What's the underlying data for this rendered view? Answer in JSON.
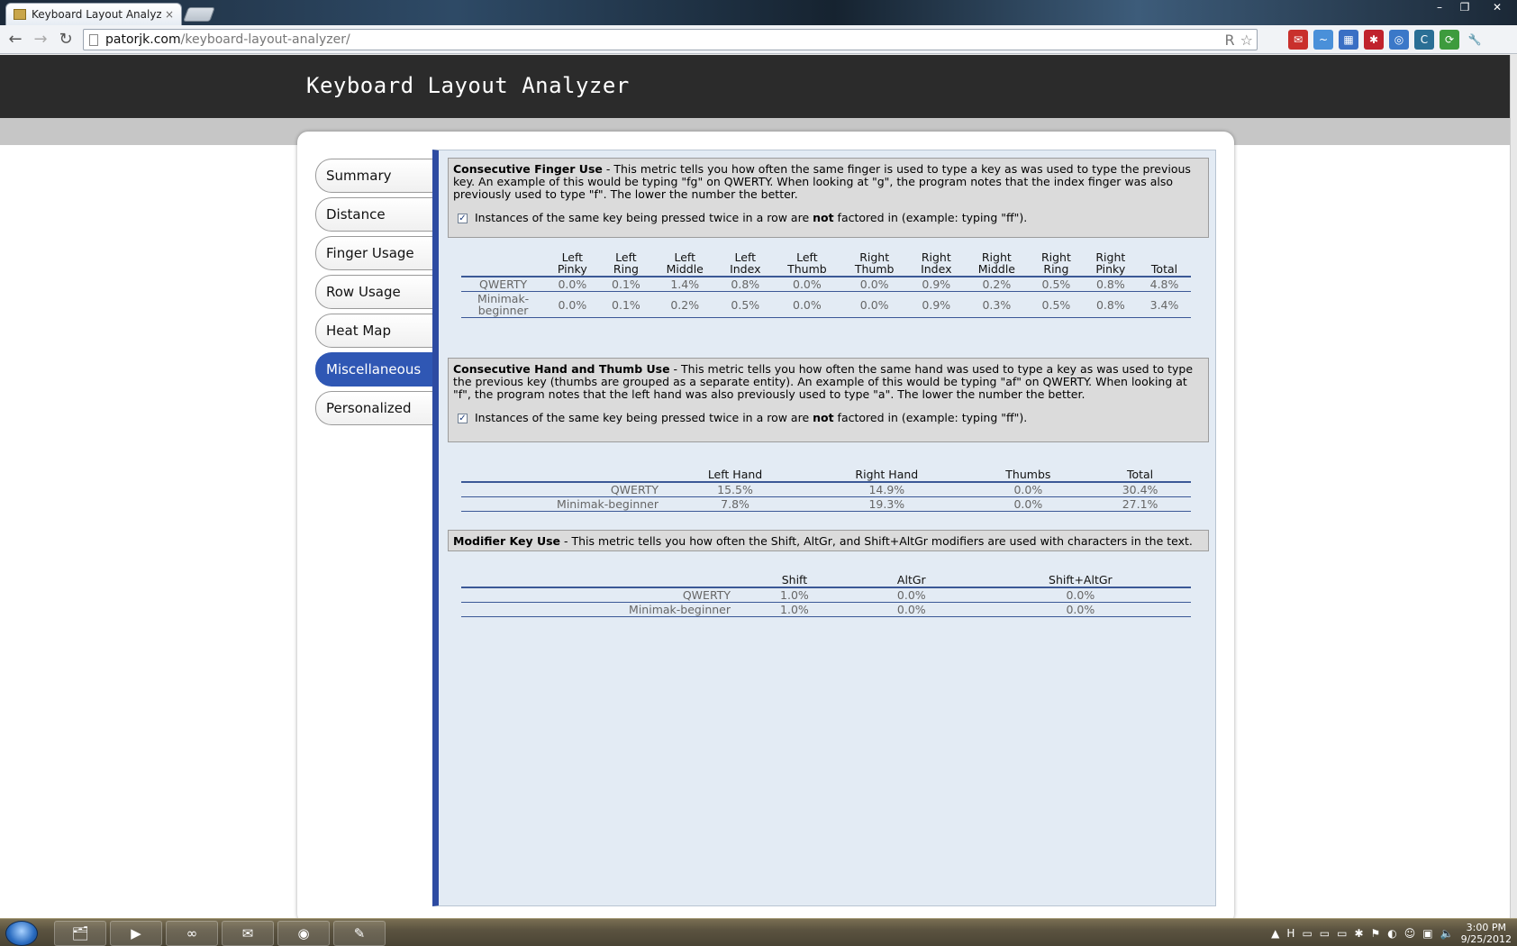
{
  "browser": {
    "tab_title": "Keyboard Layout Analyzer",
    "tab_close": "×",
    "url_domain": "patorjk.com",
    "url_path": "/keyboard-layout-analyzer/",
    "window_controls": {
      "minimize": "–",
      "maximize": "❐",
      "close": "✕"
    },
    "nav": {
      "back": "←",
      "forward": "→",
      "reload": "↻"
    },
    "omnibox_icons": {
      "reader": "R",
      "star": "☆"
    },
    "extensions": [
      {
        "name": "gmail-icon",
        "glyph": "✉",
        "color": "#c9302c"
      },
      {
        "name": "tweet-icon",
        "glyph": "~",
        "color": "#4a90d9"
      },
      {
        "name": "calendar-icon",
        "glyph": "▦",
        "color": "#3a6fc4"
      },
      {
        "name": "lastpass-icon",
        "glyph": "✱",
        "color": "#c0222c"
      },
      {
        "name": "chat-icon",
        "glyph": "◎",
        "color": "#3b78c8"
      },
      {
        "name": "css-icon",
        "glyph": "C",
        "color": "#2a6f95"
      },
      {
        "name": "refresh-ext-icon",
        "glyph": "⟳",
        "color": "#3d9b3d"
      },
      {
        "name": "wrench-icon",
        "glyph": "🔧",
        "color": "#f1f3f6"
      }
    ]
  },
  "site": {
    "title": "Keyboard Layout Analyzer"
  },
  "sidebar": {
    "items": [
      {
        "label": "Summary",
        "active": false
      },
      {
        "label": "Distance",
        "active": false
      },
      {
        "label": "Finger Usage",
        "active": false
      },
      {
        "label": "Row Usage",
        "active": false
      },
      {
        "label": "Heat Map",
        "active": false
      },
      {
        "label": "Miscellaneous",
        "active": true
      },
      {
        "label": "Personalized",
        "active": false
      }
    ]
  },
  "finger": {
    "title": "Consecutive Finger Use",
    "description": " - This metric tells you how often the same finger is used to type a key as was used to type the previous key. An example of this would be typing \"fg\" on QWERTY. When looking at \"g\", the program notes that the index finger was also previously used to type \"f\". The lower the number the better.",
    "checkbox_checked": true,
    "check_before": "Instances of the same key being pressed twice in a row are ",
    "check_bold": "not",
    "check_after": " factored in (example: typing \"ff\").",
    "headers": [
      [
        "Left",
        "Pinky"
      ],
      [
        "Left",
        "Ring"
      ],
      [
        "Left",
        "Middle"
      ],
      [
        "Left",
        "Index"
      ],
      [
        "Left",
        "Thumb"
      ],
      [
        "Right",
        "Thumb"
      ],
      [
        "Right",
        "Index"
      ],
      [
        "Right",
        "Middle"
      ],
      [
        "Right",
        "Ring"
      ],
      [
        "Right",
        "Pinky"
      ],
      [
        "",
        "Total"
      ]
    ],
    "rows": [
      {
        "label": "QWERTY",
        "values": [
          "0.0%",
          "0.1%",
          "1.4%",
          "0.8%",
          "0.0%",
          "0.0%",
          "0.9%",
          "0.2%",
          "0.5%",
          "0.8%",
          "4.8%"
        ]
      },
      {
        "label": "Minimak-\nbeginner",
        "values": [
          "0.0%",
          "0.1%",
          "0.2%",
          "0.5%",
          "0.0%",
          "0.0%",
          "0.9%",
          "0.3%",
          "0.5%",
          "0.8%",
          "3.4%"
        ]
      }
    ]
  },
  "hand": {
    "title": "Consecutive Hand and Thumb Use",
    "description": " - This metric tells you how often the same hand was used to type a key as was used to type the previous key (thumbs are grouped as a separate entity). An example of this would be typing \"af\" on QWERTY. When looking at \"f\", the program notes that the left hand was also previously used to type \"a\". The lower the number the better.",
    "checkbox_checked": true,
    "check_before": "Instances of the same key being pressed twice in a row are ",
    "check_bold": "not",
    "check_after": " factored in (example: typing \"ff\").",
    "headers": [
      "Left Hand",
      "Right Hand",
      "Thumbs",
      "Total"
    ],
    "rows": [
      {
        "label": "QWERTY",
        "values": [
          "15.5%",
          "14.9%",
          "0.0%",
          "30.4%"
        ]
      },
      {
        "label": "Minimak-beginner",
        "values": [
          "7.8%",
          "19.3%",
          "0.0%",
          "27.1%"
        ]
      }
    ]
  },
  "modifier": {
    "title": "Modifier Key Use",
    "description": " - This metric tells you how often the Shift, AltGr, and Shift+AltGr modifiers are used with characters in the text.",
    "headers": [
      "Shift",
      "AltGr",
      "Shift+AltGr"
    ],
    "rows": [
      {
        "label": "QWERTY",
        "values": [
          "1.0%",
          "0.0%",
          "0.0%"
        ]
      },
      {
        "label": "Minimak-beginner",
        "values": [
          "1.0%",
          "0.0%",
          "0.0%"
        ]
      }
    ]
  },
  "taskbar": {
    "apps": [
      {
        "name": "explorer-icon",
        "glyph": "🗂"
      },
      {
        "name": "media-player-icon",
        "glyph": "▶"
      },
      {
        "name": "infinity-app-icon",
        "glyph": "∞"
      },
      {
        "name": "outlook-icon",
        "glyph": "✉"
      },
      {
        "name": "chrome-icon",
        "glyph": "◉"
      },
      {
        "name": "paint-icon",
        "glyph": "✎"
      }
    ],
    "tray_glyphs": [
      "▲",
      "H",
      "▭",
      "▭",
      "▭",
      "✱",
      "⚑",
      "◐",
      "☺",
      "▣",
      "🔈"
    ],
    "time": "3:00 PM",
    "date": "9/25/2012"
  }
}
